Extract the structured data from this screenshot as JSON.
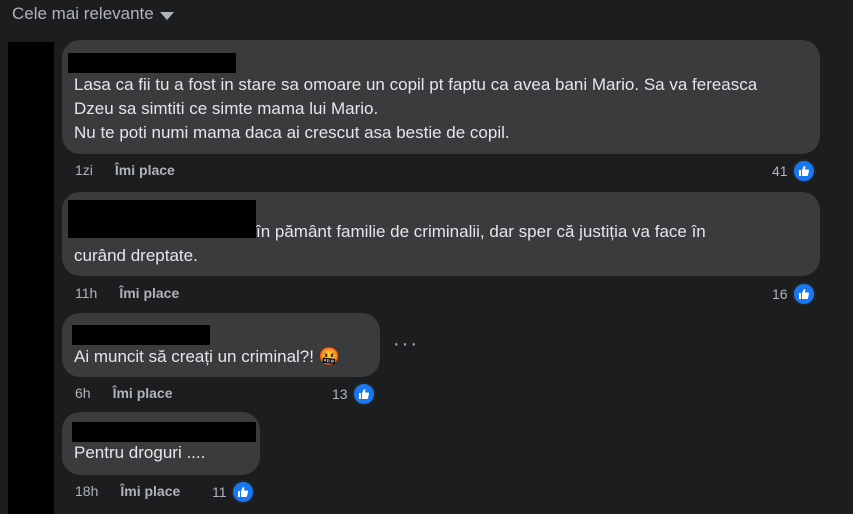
{
  "sort": {
    "label": "Cele mai relevante",
    "icon": "chevron-down-icon"
  },
  "comments": [
    {
      "text": "Lasa ca fii tu a fost in stare sa omoare un copil pt faptu ca avea bani Mario. Sa va fereasca Dzeu sa simtiti ce simte mama lui Mario.\nNu te poti numi mama daca ai crescut asa bestie de copil.",
      "time": "1zi",
      "like_label": "Îmi place",
      "reactions": "41"
    },
    {
      "text": "în pământ familie de criminalii, dar sper că justiția va face în\ncurând dreptate.",
      "time": "11h",
      "like_label": "Îmi place",
      "reactions": "16"
    },
    {
      "text": "Ai muncit să creați un criminal?! 🤬",
      "time": "6h",
      "like_label": "Îmi place",
      "reactions": "13"
    },
    {
      "text": "Pentru droguri ....",
      "time": "18h",
      "like_label": "Îmi place",
      "reactions": "11"
    }
  ],
  "more_label": "···",
  "colors": {
    "bubble": "#3a3b3c",
    "background": "#1c1d1f",
    "like": "#1877f2"
  }
}
